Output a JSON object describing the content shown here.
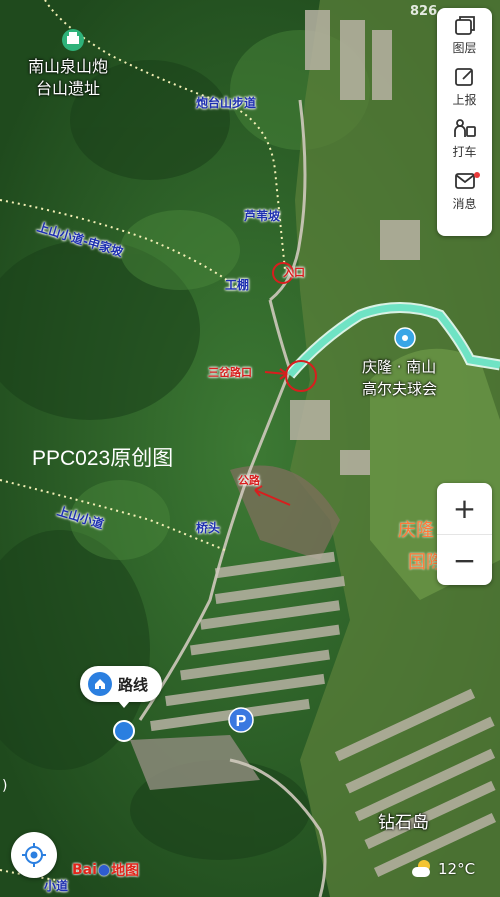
{
  "top_corner_text": "826",
  "toolbar": {
    "layers_label": "图层",
    "report_label": "上报",
    "taxi_label": "打车",
    "messages_label": "消息"
  },
  "zoom": {
    "in_label": "+",
    "out_label": "−"
  },
  "route_button": {
    "label": "路线"
  },
  "brand": {
    "logo_text": "Bai",
    "logo_text2": "地图"
  },
  "weather": {
    "temperature": "12°C"
  },
  "watermark": "PPC023原创图",
  "places": {
    "relic": "南山泉山炮\n台山遗址",
    "golf": "庆隆 · 南山\n高尔夫球会",
    "golf_partial": "庆隆",
    "golf_partial2": "国際",
    "diamond_island": "钻石岛"
  },
  "trails": {
    "paotai_trail": "炮台山步道",
    "reed_slope": "芦苇坡",
    "shenjia_trail": "上山小道-申家坡",
    "work_shed": "工棚",
    "up_trail": "上山小道",
    "bridgehead": "桥头",
    "bottom_trail": "小道"
  },
  "annotations": {
    "entrance": "入口",
    "three_fork": "三岔路口",
    "road": "公路"
  },
  "colors": {
    "forest": "#2f5e2b",
    "route": "#6fe3c4",
    "trail_label": "#1d2fb0",
    "annotation": "#d81e1e",
    "location_dot": "#2b7fe0"
  }
}
